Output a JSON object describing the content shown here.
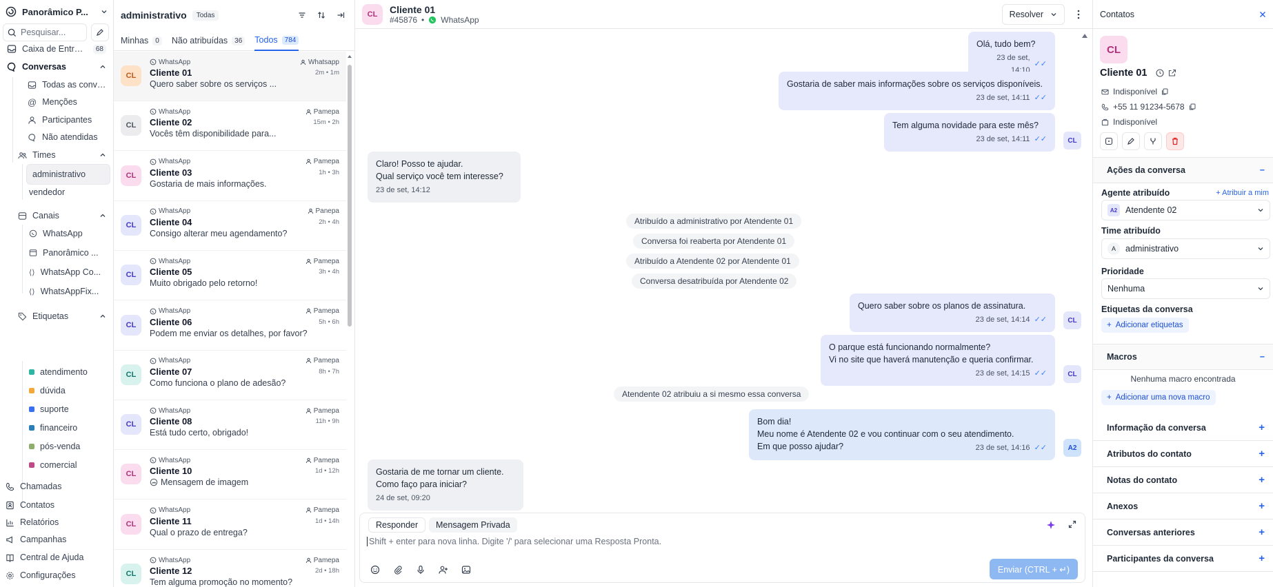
{
  "sidebar": {
    "account": "Panorâmico P...",
    "search_placeholder": "Pesquisar...",
    "inbox": {
      "label": "Caixa de Entrada",
      "count": "68"
    },
    "conversations": "Conversas",
    "conv_items": [
      "Todas as conver...",
      "Menções",
      "Participantes",
      "Não atendidas"
    ],
    "teams": "Times",
    "team_items": [
      "administrativo",
      "vendedor"
    ],
    "channels": "Canais",
    "channel_items": [
      "WhatsApp",
      "Panorâmico ...",
      "WhatsApp Co...",
      "WhatsAppFix..."
    ],
    "labels": "Etiquetas",
    "label_items": [
      {
        "name": "atendimento",
        "color": "#2fb5a3"
      },
      {
        "name": "dúvida",
        "color": "#f2a93b"
      },
      {
        "name": "suporte",
        "color": "#3b6ff2"
      },
      {
        "name": "financeiro",
        "color": "#2a7fb8"
      },
      {
        "name": "pós-venda",
        "color": "#8fae6e"
      },
      {
        "name": "comercial",
        "color": "#c04a88"
      }
    ],
    "bottom": [
      "Chamadas",
      "Contatos",
      "Relatórios",
      "Campanhas",
      "Central de Ajuda",
      "Configurações"
    ]
  },
  "list": {
    "title": "administrativo",
    "filter_tag": "Todas",
    "tabs": [
      {
        "label": "Minhas",
        "count": "0"
      },
      {
        "label": "Não atribuídas",
        "count": "36"
      },
      {
        "label": "Todos",
        "count": "784"
      }
    ],
    "items": [
      {
        "channel": "WhatsApp",
        "agent": "Whatsapp",
        "name": "Cliente 01",
        "time": "2m • 1m",
        "msg": "Quero saber sobre os serviços ...",
        "color": "#fde2c8",
        "fg": "#c2571a"
      },
      {
        "channel": "WhatsApp",
        "agent": "Pamepa",
        "name": "Cliente 02",
        "time": "15m • 2h",
        "msg": "Vocês têm disponibilidade para...",
        "color": "#ececef",
        "fg": "#4b5563"
      },
      {
        "channel": "WhatsApp",
        "agent": "Pamepa",
        "name": "Cliente 03",
        "time": "1h • 3h",
        "msg": "Gostaria de mais informações.",
        "color": "#fbdcee",
        "fg": "#b0317a"
      },
      {
        "channel": "WhatsApp",
        "agent": "Panepa",
        "name": "Cliente 04",
        "time": "2h • 4h",
        "msg": "Consigo alterar meu agendamento?",
        "color": "#e4e6fb",
        "fg": "#4338ca"
      },
      {
        "channel": "WhatsApp",
        "agent": "Pamepa",
        "name": "Cliente 05",
        "time": "3h • 4h",
        "msg": "Muito obrigado pelo retorno!",
        "color": "#e4e6fb",
        "fg": "#4338ca"
      },
      {
        "channel": "WhatsApp",
        "agent": "Pamepa",
        "name": "Cliente 06",
        "time": "5h • 6h",
        "msg": "Podem me enviar os detalhes, por favor?",
        "color": "#e4e6fb",
        "fg": "#4338ca"
      },
      {
        "channel": "WhatsApp",
        "agent": "Pamepa",
        "name": "Cliente 07",
        "time": "8h • 7h",
        "msg": "Como funciona o plano de adesão?",
        "color": "#d8f3ee",
        "fg": "#0f766e"
      },
      {
        "channel": "WhatsApp",
        "agent": "Pamepa",
        "name": "Cliente 08",
        "time": "11h • 9h",
        "msg": "Está tudo certo, obrigado!",
        "color": "#e4e6fb",
        "fg": "#4338ca"
      },
      {
        "channel": "WhatsApp",
        "agent": "Pamepa",
        "name": "Cliente 10",
        "time": "1d • 12h",
        "msg": "Mensagem de imagem",
        "color": "#fbdcee",
        "fg": "#b0317a"
      },
      {
        "channel": "WhatsApp",
        "agent": "Pamepa",
        "name": "Cliente 11",
        "time": "1d • 14h",
        "msg": "Qual o prazo de entrega?",
        "color": "#fbdcee",
        "fg": "#b0317a"
      },
      {
        "channel": "WhatsApp",
        "agent": "Pamepa",
        "name": "Cliente 12",
        "time": "2d • 18h",
        "msg": "Tem alguma promoção no momento?",
        "color": "#d8f3ee",
        "fg": "#0f766e"
      }
    ]
  },
  "chat": {
    "avatar": "CL",
    "name": "Cliente 01",
    "id": "#45876",
    "channel": "WhatsApp",
    "resolve": "Resolver",
    "messages": {
      "m1": {
        "text": "Olá, tudo bem?",
        "meta": "23 de set, 14:10"
      },
      "m2": {
        "text": "Gostaria de saber mais informações sobre os serviços disponíveis.",
        "meta": "23 de set, 14:11"
      },
      "m3": {
        "text": "Tem alguma novidade para este mês?",
        "meta": "23 de set, 14:11"
      },
      "m4": {
        "l1": "Claro! Posso te ajudar.",
        "l2": "Qual serviço você tem interesse?",
        "meta": "23 de set, 14:12"
      },
      "s1": "Atribuído a administrativo por Atendente 01",
      "s2": "Conversa foi reaberta por Atendente 01",
      "s3": "Atribuído a Atendente 02 por Atendente 01",
      "s4": "Conversa desatribuída por Atendente 02",
      "m5": {
        "text": "Quero saber sobre os planos de assinatura.",
        "meta": "23 de set, 14:14"
      },
      "m6": {
        "l1": "O parque está funcionando normalmente?",
        "l2": "Vi no site que haverá manutenção e queria confirmar.",
        "meta": "23 de set, 14:15"
      },
      "s5": "Atendente 02 atribuiu a si mesmo essa conversa",
      "m7": {
        "l1": "Bom dia!",
        "l2": "Meu nome é Atendente 02 e vou continuar com o seu atendimento.",
        "l3": "Em que posso ajudar?",
        "meta": "23 de set, 14:16"
      },
      "m8": {
        "l1": "Gostaria de me tornar um cliente.",
        "l2": "Como faço para iniciar?",
        "meta": "24 de set, 09:20"
      }
    },
    "avatar_cl": "CL",
    "avatar_a2": "A2",
    "composer": {
      "tab_reply": "Responder",
      "tab_private": "Mensagem Privada",
      "placeholder": "Shift + enter para nova linha. Digite '/' para selecionar uma Resposta Pronta.",
      "send": "Enviar (CTRL + ↵)"
    }
  },
  "contact": {
    "header": "Contatos",
    "avatar": "CL",
    "name": "Cliente 01",
    "email": "Indisponível",
    "phone": "+55 11 91234-5678",
    "company": "Indisponível",
    "actions_title": "Ações da conversa",
    "agent_label": "Agente atribuído",
    "assign_me": "Atribuir a mim",
    "agent_avatar": "A2",
    "agent_value": "Atendente 02",
    "team_label": "Time atribuído",
    "team_avatar": "A",
    "team_value": "administrativo",
    "priority_label": "Prioridade",
    "priority_value": "Nenhuma",
    "tags_label": "Etiquetas da conversa",
    "add_tags": "Adicionar etiquetas",
    "macros_title": "Macros",
    "no_macros": "Nenhuma macro encontrada",
    "add_macro": "Adicionar uma nova macro",
    "sections": [
      "Informação da conversa",
      "Atributos do contato",
      "Notas do contato",
      "Anexos",
      "Conversas anteriores",
      "Participantes da conversa"
    ]
  }
}
